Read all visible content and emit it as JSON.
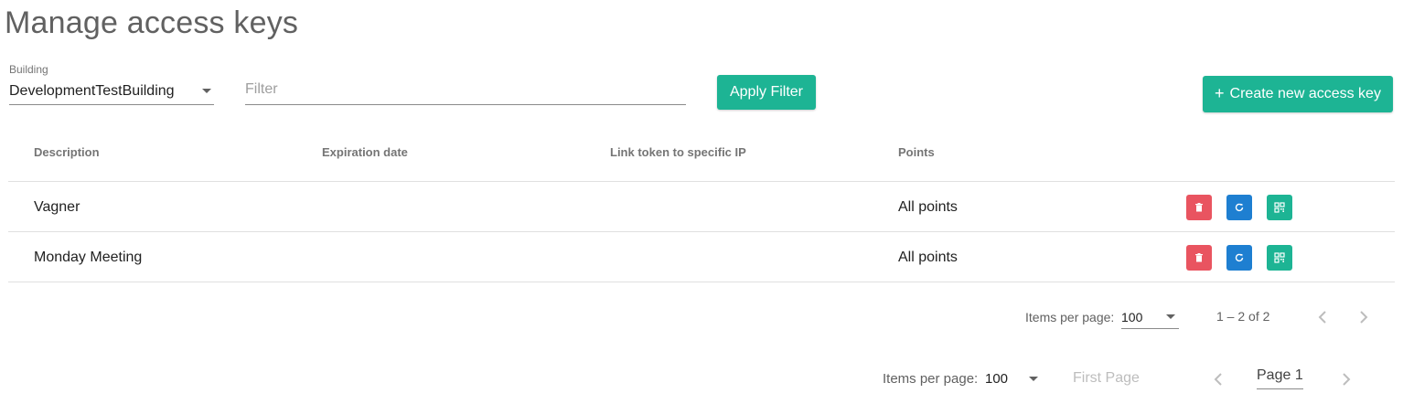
{
  "page": {
    "title": "Manage access keys"
  },
  "filters": {
    "building_label": "Building",
    "building_value": "DevelopmentTestBuilding",
    "filter_placeholder": "Filter",
    "filter_value": "",
    "apply_label": "Apply Filter",
    "create_label": "Create new access key"
  },
  "table": {
    "columns": [
      "Description",
      "Expiration date",
      "Link token to specific IP",
      "Points"
    ],
    "rows": [
      {
        "description": "Vagner",
        "expiration": "",
        "ip": "",
        "points": "All points"
      },
      {
        "description": "Monday Meeting",
        "expiration": "",
        "ip": "",
        "points": "All points"
      }
    ]
  },
  "paginator": {
    "items_per_page_label": "Items per page:",
    "items_per_page_value": "100",
    "range": "1 – 2 of 2"
  },
  "paginator2": {
    "items_per_page_label": "Items per page:",
    "items_per_page_value": "100",
    "first_page_label": "First Page",
    "page_label": "Page 1"
  },
  "colors": {
    "primary": "#1db494",
    "delete": "#e95460",
    "refresh": "#1e7fd1"
  },
  "icons": [
    "plus-icon",
    "delete-icon",
    "refresh-icon",
    "qr-code-icon",
    "chevron-left-icon",
    "chevron-right-icon",
    "caret-down-icon"
  ]
}
